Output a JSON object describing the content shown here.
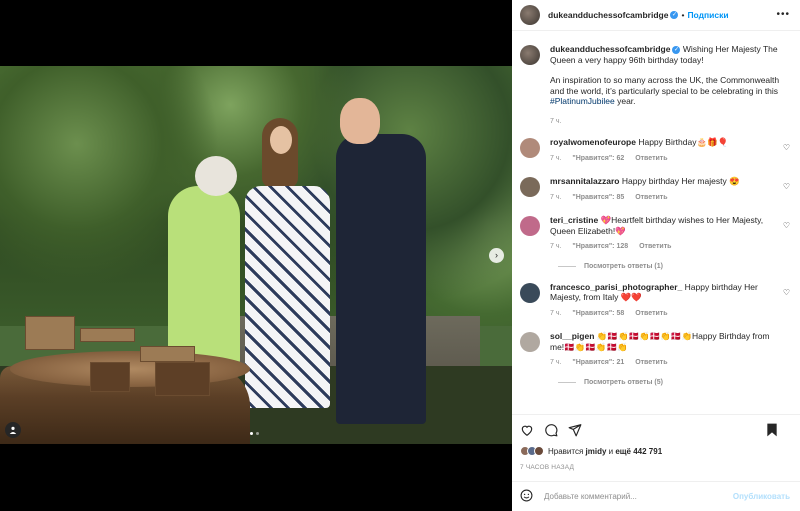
{
  "header": {
    "username": "dukeandduchessofcambridge",
    "follow_label": "Подписки",
    "more_icon": "more-horizontal-icon"
  },
  "caption": {
    "username": "dukeandduchessofcambridge",
    "text1": "Wishing Her Majesty The Queen a very happy 96th birthday today!",
    "text2_before": "An inspiration to so many across the UK, the Commonwealth and the world, it’s particularly special to be celebrating in this ",
    "hashtag": "#PlatinumJubilee",
    "text2_after": " year.",
    "time": "7 ч."
  },
  "comments": [
    {
      "username": "royalwomenofeurope",
      "text": "Happy Birthday🎂🎁🎈",
      "time": "7 ч.",
      "likes": "\"Нравится\": 62",
      "reply": "Ответить",
      "avatar_color": "#b08a7a"
    },
    {
      "username": "mrsannitalazzaro",
      "text": "Happy birthday Her majesty 😍",
      "time": "7 ч.",
      "likes": "\"Нравится\": 85",
      "reply": "Ответить",
      "avatar_color": "#7a6a5a"
    },
    {
      "username": "teri_cristine",
      "text": "💖Heartfelt birthday wishes to Her Majesty, Queen Elizabeth!💖",
      "time": "7 ч.",
      "likes": "\"Нравится\": 128",
      "reply": "Ответить",
      "view_replies": "Посмотреть ответы (1)",
      "avatar_color": "#c06a8a"
    },
    {
      "username": "francesco_parisi_photographer_",
      "text": "Happy birthday Her Majesty, from Italy ❤️❤️",
      "time": "7 ч.",
      "likes": "\"Нравится\": 58",
      "reply": "Ответить",
      "avatar_color": "#3a4a5a"
    },
    {
      "username": "sol__pigen",
      "text": "👏🇩🇰👏🇩🇰👏🇩🇰👏🇩🇰👏Happy Birthday from me!🇩🇰👏🇩🇰👏🇩🇰👏",
      "time": "7 ч.",
      "likes": "\"Нравится\": 21",
      "reply": "Ответить",
      "view_replies": "Посмотреть ответы (5)",
      "avatar_color": "#b0a8a0"
    }
  ],
  "likes": {
    "prefix": "Нравится ",
    "user": "jmidy",
    "middle": " и ",
    "count": "ещё 442 791"
  },
  "time_ago": "7 ЧАСОВ НАЗАД",
  "add_comment": {
    "placeholder": "Добавьте комментарий...",
    "post_label": "Опубликовать"
  },
  "icons": {
    "like": "heart-icon",
    "comment": "comment-icon",
    "share": "share-icon",
    "save": "bookmark-icon",
    "emoji": "emoji-icon",
    "next": "chevron-right-icon",
    "tagged": "user-tag-icon"
  },
  "colors": {
    "accent": "#0095f6",
    "verified": "#3897f0",
    "muted": "#8e8e8e"
  }
}
